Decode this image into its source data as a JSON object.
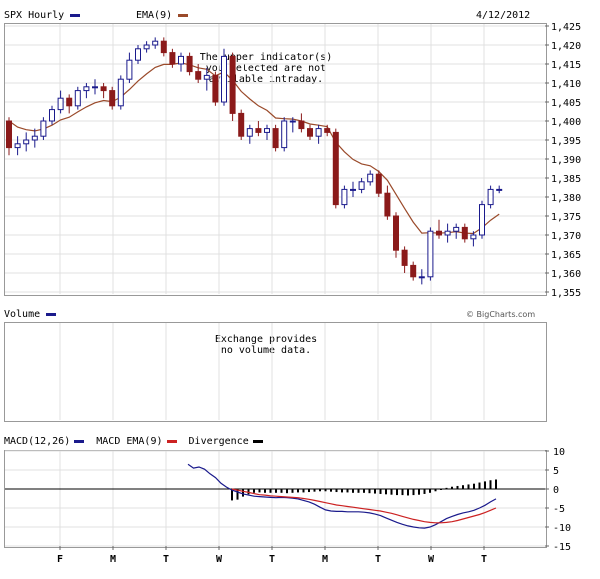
{
  "header": {
    "symbol_label": "SPX Hourly",
    "ema_label": "EMA(9)",
    "date": "4/12/2012",
    "colors": {
      "price": "#1a1a8c",
      "ema": "#9a4a2a"
    }
  },
  "price_note": "The upper indicator(s)\nyou selected are not\navailable intraday.",
  "volume_panel": {
    "label": "Volume",
    "brand": "© BigCharts.com",
    "note": "Exchange provides\nno volume data."
  },
  "macd_panel": {
    "macd_label": "MACD(12,26)",
    "ema_label": "MACD EMA(9)",
    "div_label": "Divergence",
    "colors": {
      "macd": "#1a1a8c",
      "ema": "#cc2222",
      "div": "#000000"
    }
  },
  "x_ticks": [
    "F",
    "M",
    "T",
    "W",
    "T",
    "M",
    "T",
    "W",
    "T"
  ],
  "chart_data": [
    {
      "type": "candlestick",
      "title": "SPX Hourly",
      "ylim": [
        1355,
        1425
      ],
      "y_ticks": [
        "1,425",
        "1,420",
        "1,415",
        "1,410",
        "1,405",
        "1,400",
        "1,395",
        "1,390",
        "1,385",
        "1,380",
        "1,375",
        "1,370",
        "1,365",
        "1,360",
        "1,355"
      ],
      "candles": [
        {
          "o": 1400,
          "h": 1401,
          "l": 1391,
          "c": 1393
        },
        {
          "o": 1393,
          "h": 1396,
          "l": 1391,
          "c": 1394
        },
        {
          "o": 1394,
          "h": 1397,
          "l": 1392,
          "c": 1395
        },
        {
          "o": 1395,
          "h": 1398,
          "l": 1393,
          "c": 1396
        },
        {
          "o": 1396,
          "h": 1401,
          "l": 1395,
          "c": 1400
        },
        {
          "o": 1400,
          "h": 1404,
          "l": 1399,
          "c": 1403
        },
        {
          "o": 1403,
          "h": 1408,
          "l": 1402,
          "c": 1406
        },
        {
          "o": 1406,
          "h": 1407,
          "l": 1402,
          "c": 1404
        },
        {
          "o": 1404,
          "h": 1409,
          "l": 1403,
          "c": 1408
        },
        {
          "o": 1408,
          "h": 1410,
          "l": 1406,
          "c": 1409
        },
        {
          "o": 1409,
          "h": 1411,
          "l": 1407,
          "c": 1409
        },
        {
          "o": 1409,
          "h": 1410,
          "l": 1406,
          "c": 1408
        },
        {
          "o": 1408,
          "h": 1409,
          "l": 1403,
          "c": 1404
        },
        {
          "o": 1404,
          "h": 1412,
          "l": 1403,
          "c": 1411
        },
        {
          "o": 1411,
          "h": 1418,
          "l": 1410,
          "c": 1416
        },
        {
          "o": 1416,
          "h": 1420,
          "l": 1415,
          "c": 1419
        },
        {
          "o": 1419,
          "h": 1421,
          "l": 1418,
          "c": 1420
        },
        {
          "o": 1420,
          "h": 1422,
          "l": 1419,
          "c": 1421
        },
        {
          "o": 1421,
          "h": 1422,
          "l": 1417,
          "c": 1418
        },
        {
          "o": 1418,
          "h": 1419,
          "l": 1414,
          "c": 1415
        },
        {
          "o": 1415,
          "h": 1418,
          "l": 1413,
          "c": 1417
        },
        {
          "o": 1417,
          "h": 1418,
          "l": 1412,
          "c": 1413
        },
        {
          "o": 1413,
          "h": 1415,
          "l": 1410,
          "c": 1411
        },
        {
          "o": 1411,
          "h": 1414,
          "l": 1408,
          "c": 1412
        },
        {
          "o": 1412,
          "h": 1413,
          "l": 1404,
          "c": 1405
        },
        {
          "o": 1405,
          "h": 1419,
          "l": 1404,
          "c": 1417
        },
        {
          "o": 1417,
          "h": 1418,
          "l": 1400,
          "c": 1402
        },
        {
          "o": 1402,
          "h": 1403,
          "l": 1395,
          "c": 1396
        },
        {
          "o": 1396,
          "h": 1399,
          "l": 1394,
          "c": 1398
        },
        {
          "o": 1398,
          "h": 1400,
          "l": 1396,
          "c": 1397
        },
        {
          "o": 1397,
          "h": 1399,
          "l": 1395,
          "c": 1398
        },
        {
          "o": 1398,
          "h": 1399,
          "l": 1392,
          "c": 1393
        },
        {
          "o": 1393,
          "h": 1401,
          "l": 1392,
          "c": 1400
        },
        {
          "o": 1400,
          "h": 1401,
          "l": 1397,
          "c": 1400
        },
        {
          "o": 1400,
          "h": 1402,
          "l": 1397,
          "c": 1398
        },
        {
          "o": 1398,
          "h": 1399,
          "l": 1395,
          "c": 1396
        },
        {
          "o": 1396,
          "h": 1399,
          "l": 1394,
          "c": 1398
        },
        {
          "o": 1398,
          "h": 1399,
          "l": 1396,
          "c": 1397
        },
        {
          "o": 1397,
          "h": 1398,
          "l": 1377,
          "c": 1378
        },
        {
          "o": 1378,
          "h": 1383,
          "l": 1377,
          "c": 1382
        },
        {
          "o": 1382,
          "h": 1384,
          "l": 1380,
          "c": 1382
        },
        {
          "o": 1382,
          "h": 1385,
          "l": 1381,
          "c": 1384
        },
        {
          "o": 1384,
          "h": 1387,
          "l": 1383,
          "c": 1386
        },
        {
          "o": 1386,
          "h": 1387,
          "l": 1380,
          "c": 1381
        },
        {
          "o": 1381,
          "h": 1383,
          "l": 1374,
          "c": 1375
        },
        {
          "o": 1375,
          "h": 1376,
          "l": 1364,
          "c": 1366
        },
        {
          "o": 1366,
          "h": 1367,
          "l": 1360,
          "c": 1362
        },
        {
          "o": 1362,
          "h": 1363,
          "l": 1358,
          "c": 1359
        },
        {
          "o": 1359,
          "h": 1361,
          "l": 1357,
          "c": 1359
        },
        {
          "o": 1359,
          "h": 1372,
          "l": 1358,
          "c": 1371
        },
        {
          "o": 1371,
          "h": 1374,
          "l": 1369,
          "c": 1370
        },
        {
          "o": 1370,
          "h": 1373,
          "l": 1368,
          "c": 1371
        },
        {
          "o": 1371,
          "h": 1373,
          "l": 1369,
          "c": 1372
        },
        {
          "o": 1372,
          "h": 1373,
          "l": 1368,
          "c": 1369
        },
        {
          "o": 1369,
          "h": 1371,
          "l": 1367,
          "c": 1370
        },
        {
          "o": 1370,
          "h": 1379,
          "l": 1369,
          "c": 1378
        },
        {
          "o": 1378,
          "h": 1383,
          "l": 1377,
          "c": 1382
        },
        {
          "o": 1382,
          "h": 1383,
          "l": 1381,
          "c": 1382
        }
      ],
      "ema": [
        1400,
        1398.4,
        1397.7,
        1397.4,
        1397.9,
        1398.9,
        1400.3,
        1401.0,
        1402.4,
        1403.7,
        1404.8,
        1405.4,
        1405.1,
        1406.3,
        1408.3,
        1410.5,
        1412.4,
        1414.1,
        1414.9,
        1414.9,
        1415.3,
        1414.8,
        1414.0,
        1413.6,
        1411.9,
        1412.9,
        1410.7,
        1407.8,
        1405.8,
        1404.0,
        1402.8,
        1400.8,
        1400.6,
        1400.5,
        1400.0,
        1399.2,
        1398.9,
        1398.5,
        1394.4,
        1391.9,
        1389.9,
        1388.7,
        1388.2,
        1386.7,
        1384.4,
        1380.7,
        1377.0,
        1373.4,
        1370.5,
        1370.6,
        1370.5,
        1370.6,
        1370.9,
        1370.5,
        1370.4,
        1371.9,
        1373.9,
        1375.5
      ]
    },
    {
      "type": "line",
      "title": "MACD",
      "ylim": [
        -15,
        10
      ],
      "y_ticks": [
        "10",
        "5",
        "0",
        "-5",
        "-10",
        "-15"
      ],
      "series": [
        {
          "name": "MACD(12,26)",
          "values": [
            6.5,
            5.5,
            5.8,
            5.2,
            4.0,
            3.0,
            1.5,
            0.5,
            -0.3,
            -0.8,
            -1.3,
            -1.6,
            -1.9,
            -2.0,
            -2.1,
            -2.2,
            -2.3,
            -2.2,
            -2.3,
            -2.4,
            -2.6,
            -3.0,
            -3.4,
            -4.0,
            -4.8,
            -5.5,
            -5.8,
            -5.9,
            -5.9,
            -6.0,
            -6.0,
            -6.0,
            -6.1,
            -6.3,
            -6.6,
            -7.0,
            -7.6,
            -8.2,
            -8.8,
            -9.3,
            -9.7,
            -10.0,
            -10.2,
            -10.3,
            -10.0,
            -9.4,
            -8.6,
            -7.8,
            -7.2,
            -6.7,
            -6.3,
            -6.0,
            -5.6,
            -5.0,
            -4.3,
            -3.4,
            -2.6
          ]
        },
        {
          "name": "MACD EMA(9)",
          "values": [
            null,
            null,
            null,
            null,
            null,
            null,
            null,
            null,
            0.0,
            -0.3,
            -0.6,
            -0.9,
            -1.2,
            -1.5,
            -1.6,
            -1.8,
            -1.9,
            -2.0,
            -2.1,
            -2.2,
            -2.3,
            -2.5,
            -2.7,
            -3.0,
            -3.3,
            -3.6,
            -3.9,
            -4.2,
            -4.4,
            -4.6,
            -4.8,
            -5.0,
            -5.2,
            -5.4,
            -5.6,
            -5.8,
            -6.1,
            -6.4,
            -6.8,
            -7.2,
            -7.6,
            -8.0,
            -8.3,
            -8.6,
            -8.8,
            -8.9,
            -8.9,
            -8.8,
            -8.6,
            -8.3,
            -7.9,
            -7.5,
            -7.1,
            -6.7,
            -6.2,
            -5.6,
            -5.0
          ]
        },
        {
          "name": "Divergence",
          "values": [
            null,
            null,
            null,
            null,
            null,
            null,
            null,
            null,
            -3.0,
            -2.8,
            -2.0,
            -1.4,
            -1.0,
            -0.9,
            -1.0,
            -1.0,
            -1.0,
            -1.0,
            -1.1,
            -1.0,
            -0.9,
            -0.9,
            -0.8,
            -0.7,
            -0.6,
            -0.6,
            -0.7,
            -0.8,
            -0.9,
            -0.9,
            -1.0,
            -1.0,
            -1.0,
            -1.1,
            -1.2,
            -1.3,
            -1.4,
            -1.5,
            -1.6,
            -1.6,
            -1.7,
            -1.6,
            -1.5,
            -1.3,
            -1.0,
            -0.6,
            -0.2,
            0.3,
            0.6,
            0.8,
            1.0,
            1.2,
            1.4,
            1.7,
            2.0,
            2.3,
            2.5
          ]
        }
      ]
    }
  ]
}
